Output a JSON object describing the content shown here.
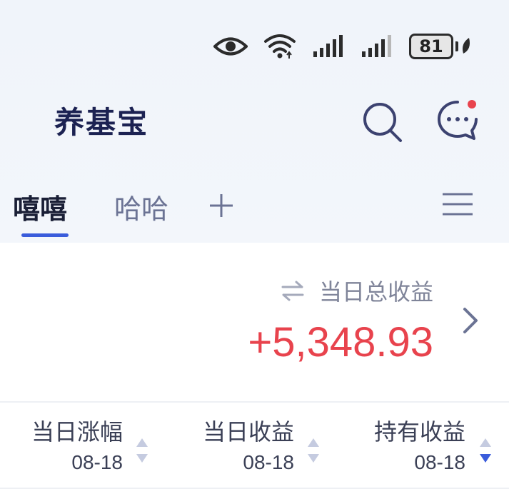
{
  "status_bar": {
    "battery_level": "81",
    "icons": [
      "eye-icon",
      "wifi-icon",
      "signal-icon",
      "signal-icon",
      "battery-icon",
      "leaf-icon"
    ]
  },
  "header": {
    "title": "养基宝",
    "icons": [
      "search-icon",
      "message-icon"
    ],
    "message_badge_color": "#e8434d"
  },
  "tabs": [
    {
      "label": "嘻嘻",
      "active": true
    },
    {
      "label": "哈哈",
      "active": false
    }
  ],
  "accent_color": "#3a5cdb",
  "summary": {
    "label": "当日总收益",
    "value": "+5,348.93",
    "value_color": "#e8434d"
  },
  "columns": [
    {
      "title": "当日涨幅",
      "date": "08-18",
      "sort": "none"
    },
    {
      "title": "当日收益",
      "date": "08-18",
      "sort": "none"
    },
    {
      "title": "持有收益",
      "date": "08-18",
      "sort": "descending"
    }
  ]
}
